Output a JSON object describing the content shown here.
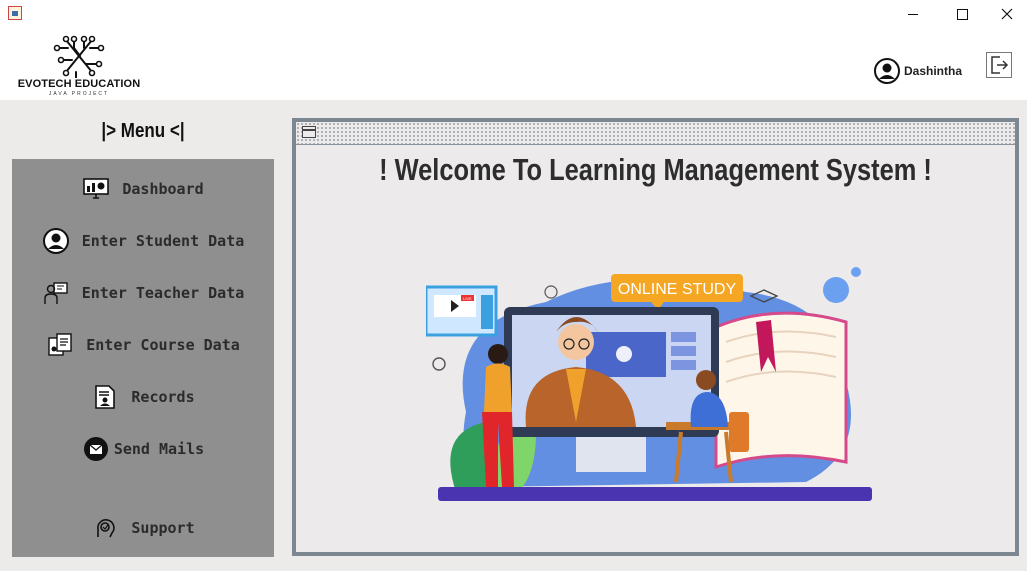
{
  "window": {
    "controls": [
      "minimize",
      "maximize",
      "close"
    ]
  },
  "brand": {
    "name": "EVOTECH EDUCATION",
    "subtitle": "JAVA PROJECT"
  },
  "user": {
    "name": "Dashintha",
    "avatar_icon": "user-circle-icon",
    "logout_icon": "logout-icon"
  },
  "menu": {
    "title": "|> Menu <|",
    "items": [
      {
        "label": "Dashboard",
        "icon": "dashboard-monitor-icon"
      },
      {
        "label": "Enter Student Data",
        "icon": "student-icon"
      },
      {
        "label": "Enter Teacher Data",
        "icon": "teacher-icon"
      },
      {
        "label": "Enter Course Data",
        "icon": "course-icon"
      },
      {
        "label": "Records",
        "icon": "records-icon"
      },
      {
        "label": "Send Mails",
        "icon": "mail-icon"
      },
      {
        "label": "Support",
        "icon": "support-icon"
      }
    ]
  },
  "main": {
    "welcome": "! Welcome To Learning Management System !",
    "illustration": {
      "badge": "ONLINE STUDY",
      "video_tag": "LIVE"
    }
  },
  "colors": {
    "sidebar_bg": "#8f8f8f",
    "workspace_bg": "#edebea",
    "panel_border": "#7d8792",
    "text_dark": "#2d2d2d",
    "accent_orange": "#f5a623",
    "accent_purple": "#4a34b0"
  }
}
